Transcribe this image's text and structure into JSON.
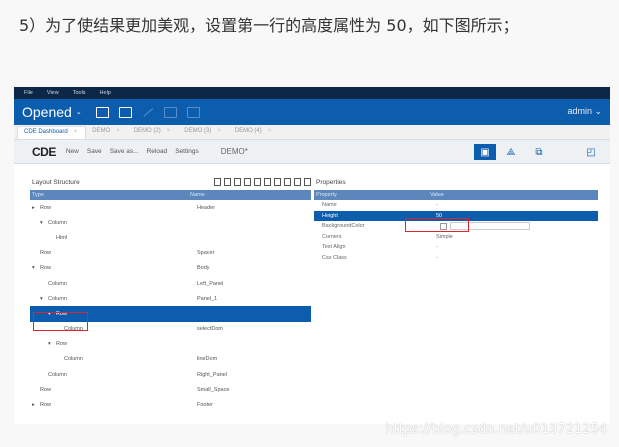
{
  "caption": "5）为了使结果更加美观，设置第一行的高度属性为 50，如下图所示；",
  "watermark": "https://blog.csdn.net/u013721254",
  "app": {
    "menu": [
      "File",
      "View",
      "Tools",
      "Help"
    ],
    "brand": "Opened",
    "user": "admin",
    "tabs": [
      {
        "label": "CDE Dashboard",
        "active": true
      },
      {
        "label": "DEMO",
        "active": false
      },
      {
        "label": "DEMO (2)",
        "active": false
      },
      {
        "label": "DEMO (3)",
        "active": false
      },
      {
        "label": "DEMO (4)",
        "active": false
      }
    ],
    "toolbar": {
      "logo": "CDE",
      "actions": [
        "New",
        "Save",
        "Save as...",
        "Reload",
        "Settings"
      ],
      "dashboard_name": "DEMO*"
    }
  },
  "layout_panel": {
    "title": "Layout Structure",
    "col_type": "Type",
    "col_name": "Name",
    "rows": [
      {
        "type": "Row",
        "name": "Header",
        "expander": "▸",
        "indent": 0,
        "selected": false
      },
      {
        "type": "Column",
        "name": "",
        "expander": "▾",
        "indent": 1,
        "selected": false
      },
      {
        "type": "Html",
        "name": "",
        "expander": "",
        "indent": 2,
        "selected": false
      },
      {
        "type": "Row",
        "name": "Spacer",
        "expander": "",
        "indent": 0,
        "selected": false
      },
      {
        "type": "Row",
        "name": "Body",
        "expander": "▾",
        "indent": 0,
        "selected": false
      },
      {
        "type": "Column",
        "name": "Left_Panel",
        "expander": "",
        "indent": 1,
        "selected": false
      },
      {
        "type": "Column",
        "name": "Panel_1",
        "expander": "▾",
        "indent": 1,
        "selected": false
      },
      {
        "type": "Row",
        "name": "",
        "expander": "▾",
        "indent": 2,
        "selected": true
      },
      {
        "type": "Column",
        "name": "selectDom",
        "expander": "",
        "indent": 3,
        "selected": false
      },
      {
        "type": "Row",
        "name": "",
        "expander": "▾",
        "indent": 2,
        "selected": false
      },
      {
        "type": "Column",
        "name": "lineDom",
        "expander": "",
        "indent": 3,
        "selected": false
      },
      {
        "type": "Column",
        "name": "Right_Panel",
        "expander": "",
        "indent": 1,
        "selected": false
      },
      {
        "type": "Row",
        "name": "Small_Space",
        "expander": "",
        "indent": 0,
        "selected": false
      },
      {
        "type": "Row",
        "name": "Footer",
        "expander": "▸",
        "indent": 0,
        "selected": false
      }
    ]
  },
  "properties_panel": {
    "title": "Properties",
    "col_property": "Property",
    "col_value": "Value",
    "rows": [
      {
        "key": "Name",
        "value": "-"
      },
      {
        "key": "Height",
        "value": "50"
      },
      {
        "key": "BackgroundColor",
        "value": ""
      },
      {
        "key": "Corners",
        "value": "Simple"
      },
      {
        "key": "Text Align",
        "value": "-"
      },
      {
        "key": "Css Class",
        "value": "-"
      }
    ]
  }
}
